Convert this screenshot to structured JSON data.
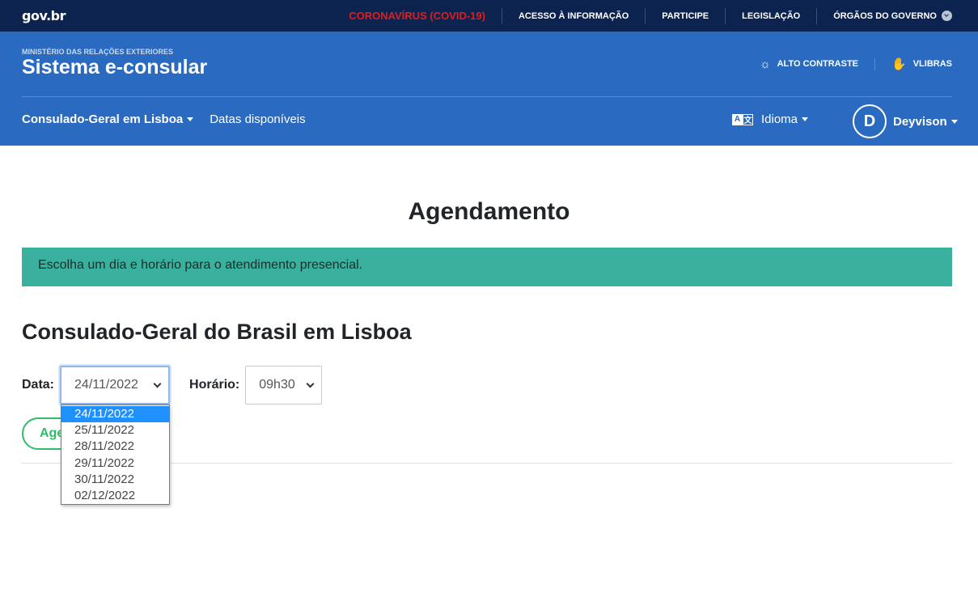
{
  "govbar": {
    "logo": "gov.br",
    "links": [
      {
        "label": "CORONAVÍRUS (COVID-19)"
      },
      {
        "label": "ACESSO À INFORMAÇÃO"
      },
      {
        "label": "PARTICIPE"
      },
      {
        "label": "LEGISLAÇÃO"
      },
      {
        "label": "ÓRGÃOS DO GOVERNO"
      }
    ]
  },
  "header": {
    "ministry": "MINISTÉRIO DAS RELAÇÕES EXTERIORES",
    "title": "Sistema e-consular",
    "tools": {
      "contrast": "ALTO CONTRASTE",
      "vlibras": "VLIBRAS"
    },
    "nav": {
      "consulate": "Consulado-Geral em Lisboa",
      "dates": "Datas disponíveis"
    },
    "language": "Idioma",
    "user": {
      "initial": "D",
      "name": "Deyvison"
    }
  },
  "main": {
    "title": "Agendamento",
    "alert": "Escolha um dia e horário para o atendimento presencial.",
    "consulate_heading": "Consulado-Geral do Brasil em Lisboa",
    "date_label": "Data:",
    "date_value": "24/11/2022",
    "time_label": "Horário:",
    "time_value": "09h30",
    "submit_label": "Agendar",
    "date_options": [
      "24/11/2022",
      "25/11/2022",
      "28/11/2022",
      "29/11/2022",
      "30/11/2022",
      "02/12/2022"
    ]
  },
  "colors": {
    "govbar": "#0c2350",
    "header": "#2a6ac0",
    "alert": "#3ab09e",
    "covid": "#e11c1c",
    "button": "#2fbd6a",
    "selected_option": "#1e90ff"
  }
}
